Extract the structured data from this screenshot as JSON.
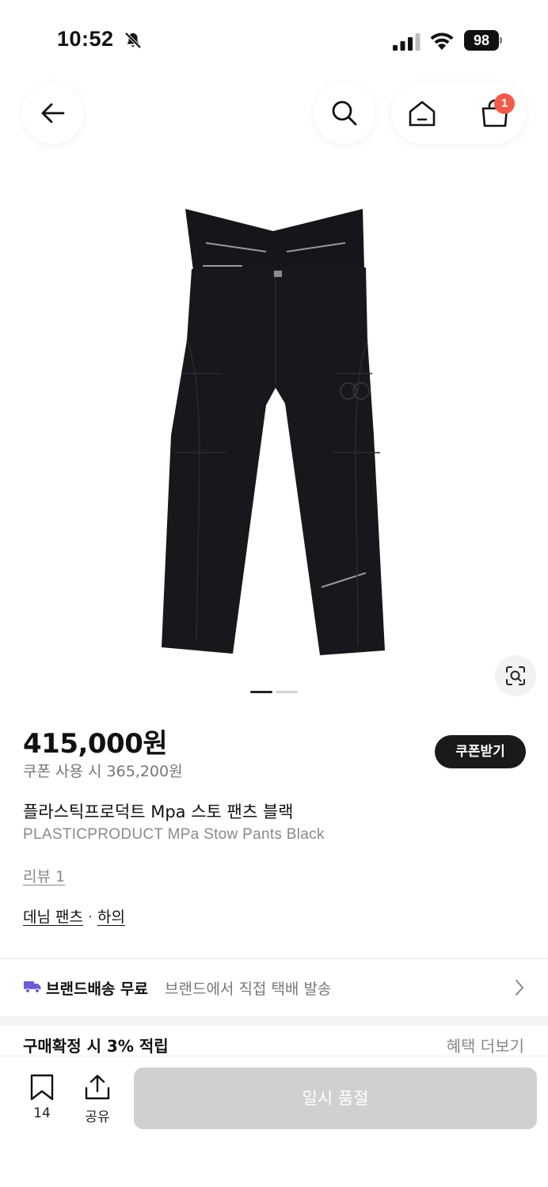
{
  "status_bar": {
    "time": "10:52",
    "battery": "98"
  },
  "nav": {
    "cart_count": "1"
  },
  "product": {
    "price": "415,000원",
    "coupon_price": "쿠폰 사용 시 365,200원",
    "coupon_button": "쿠폰받기",
    "title_ko": "플라스틱프로덕트 Mpa 스토 팬츠 블랙",
    "title_en": "PLASTICPRODUCT MPa Stow Pants Black",
    "review": "리뷰 1",
    "category_main": "데님 팬츠",
    "category_separator": "·",
    "category_sub": "하의",
    "image_pager": {
      "current": 1,
      "total": 2
    }
  },
  "shipping": {
    "label": "브랜드배송 무료",
    "description": "브랜드에서 직접 택배 발송"
  },
  "points": {
    "label": "구매확정 시 3% 적립",
    "more": "혜택 더보기"
  },
  "bottom_bar": {
    "bookmark_count": "14",
    "share_label": "공유",
    "purchase_button": "일시 품절"
  },
  "icons": [
    "bell-off-icon",
    "signal-icon",
    "wifi-icon",
    "battery-icon",
    "back-arrow-icon",
    "search-icon",
    "home-icon",
    "cart-icon",
    "visual-search-icon",
    "truck-icon",
    "chevron-right-icon",
    "bookmark-icon",
    "share-icon"
  ],
  "colors": {
    "badge": "#f25a4a",
    "truck": "#6b5bd6",
    "soldout": "#d0d0d0",
    "coupon_button": "#1a1a1a"
  }
}
